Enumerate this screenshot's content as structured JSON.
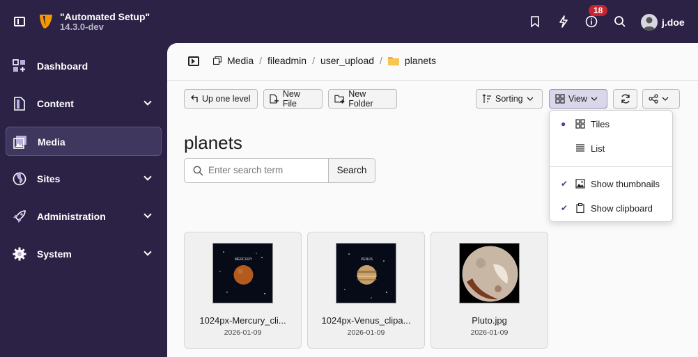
{
  "topbar": {
    "site_name": "\"Automated Setup\"",
    "site_version": "14.3.0-dev",
    "notification_count": "18",
    "user_name": "j.doe"
  },
  "nav": {
    "items": [
      {
        "label": "Dashboard",
        "icon": "dashboard-icon",
        "expandable": false,
        "active": false
      },
      {
        "label": "Content",
        "icon": "content-icon",
        "expandable": true,
        "active": false
      },
      {
        "label": "Media",
        "icon": "media-icon",
        "expandable": false,
        "active": true
      },
      {
        "label": "Sites",
        "icon": "globe-icon",
        "expandable": true,
        "active": false
      },
      {
        "label": "Administration",
        "icon": "rocket-icon",
        "expandable": true,
        "active": false
      },
      {
        "label": "System",
        "icon": "gear-icon",
        "expandable": true,
        "active": false
      }
    ]
  },
  "breadcrumb": [
    "Media",
    "fileadmin",
    "user_upload",
    "planets"
  ],
  "toolbar": {
    "up_label": "Up one level",
    "new_file_label": "New File",
    "new_folder_label": "New Folder",
    "sorting_label": "Sorting",
    "view_label": "View"
  },
  "folder_title": "planets",
  "search": {
    "placeholder": "Enter search term",
    "button_label": "Search"
  },
  "files": [
    {
      "name": "1024px-Mercury_cli...",
      "date": "2026-01-09",
      "thumb_label": "MERCURY",
      "planet_color": "#b35a1f"
    },
    {
      "name": "1024px-Venus_clipa...",
      "date": "2026-01-09",
      "thumb_label": "VENUS",
      "planet_color": "#c7a16a"
    },
    {
      "name": "Pluto.jpg",
      "date": "2026-01-09",
      "thumb_label": "",
      "planet_color": "#c9b7a6"
    }
  ],
  "view_menu": {
    "tiles_label": "Tiles",
    "list_label": "List",
    "show_thumbnails_label": "Show thumbnails",
    "show_clipboard_label": "Show clipboard",
    "selected": "Tiles",
    "show_thumbnails": true,
    "show_clipboard": true
  },
  "colors": {
    "sidebar_bg": "#2b2246",
    "accent": "#4a3ea0",
    "badge": "#c8242f",
    "logo": "#f49700"
  }
}
